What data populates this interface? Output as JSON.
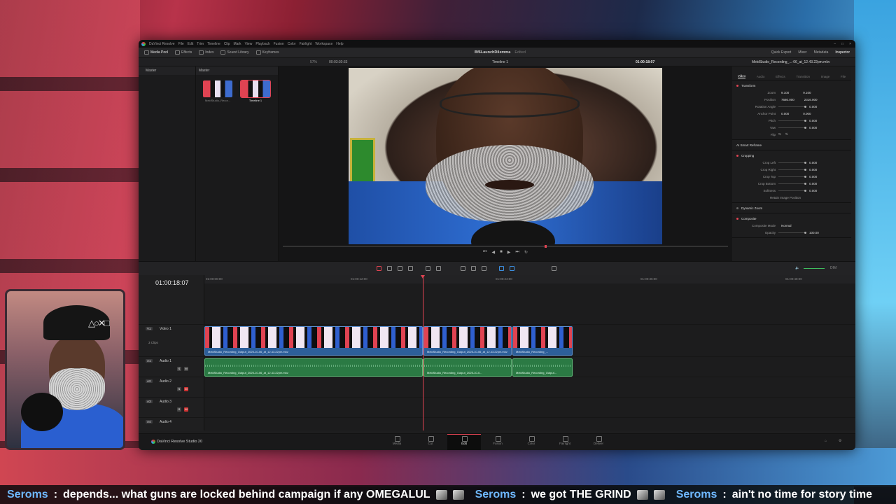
{
  "app": {
    "menu": [
      "DaVinci Resolve",
      "File",
      "Edit",
      "Trim",
      "Timeline",
      "Clip",
      "Mark",
      "View",
      "Playback",
      "Fusion",
      "Color",
      "Fairlight",
      "Workspace",
      "Help"
    ],
    "toolbar_left": [
      "Media Pool",
      "Effects",
      "Index",
      "Sound Library",
      "Keyframes"
    ],
    "project_title": "Bf6LaunchDilemma",
    "project_status": "Edited",
    "toolbar_right": [
      "Quick Export",
      "Mixer",
      "Metadata",
      "Inspector"
    ],
    "zoom": "57%",
    "source_timecode": "00:03:30:33",
    "timeline_name": "Timeline 1",
    "record_timecode": "01:00:18:07",
    "clip_name": "MeldStudio_Recording_...-06_at_12.43.22pm.mkv"
  },
  "bins": {
    "header": "Master"
  },
  "media_pool": {
    "header": "Master",
    "items": [
      {
        "label": "MeldStudio_Recor..."
      },
      {
        "label": "Timeline 1"
      }
    ]
  },
  "inspector": {
    "tabs": [
      "Video",
      "Audio",
      "Effects",
      "Transition",
      "Image",
      "File"
    ],
    "transform": {
      "title": "Transform",
      "zoom_label": "Zoom",
      "zoom_x": "9.100",
      "zoom_y": "9.100",
      "position_label": "Position",
      "position_x": "7680.000",
      "position_y": "2316.000",
      "rotation_label": "Rotation Angle",
      "rotation": "0.000",
      "anchor_label": "Anchor Point",
      "anchor_x": "0.000",
      "anchor_y": "0.000",
      "pitch_label": "Pitch",
      "pitch": "0.000",
      "yaw_label": "Yaw",
      "yaw": "0.000",
      "flip_label": "Flip"
    },
    "smart_reframe": "AI Smart Reframe",
    "cropping": {
      "title": "Cropping",
      "left_label": "Crop Left",
      "left": "0.000",
      "right_label": "Crop Right",
      "right": "0.000",
      "top_label": "Crop Top",
      "top": "0.000",
      "bottom_label": "Crop Bottom",
      "bottom": "0.000",
      "softness_label": "Softness",
      "softness": "0.000",
      "retain_label": "Retain Image Position"
    },
    "dynamic_zoom": {
      "title": "Dynamic Zoom"
    },
    "composite": {
      "title": "Composite",
      "mode_label": "Composite Mode",
      "mode": "Normal",
      "opacity_label": "Opacity",
      "opacity": "100.00"
    }
  },
  "timeline": {
    "timecode": "01:00:18:07",
    "ruler": [
      "01:00:00:00",
      "01:00:12:00",
      "01:00:24:00",
      "01:00:36:00",
      "01:00:48:00"
    ],
    "tracks": [
      {
        "tag": "V1",
        "name": "Video 1",
        "sub": "3 Clips"
      },
      {
        "tag": "A1",
        "name": "Audio 1",
        "level": "2.0"
      },
      {
        "tag": "A2",
        "name": "Audio 2",
        "level": "2.0"
      },
      {
        "tag": "A3",
        "name": "Audio 3",
        "level": "2.0"
      },
      {
        "tag": "A4",
        "name": "Audio 4",
        "level": "2.0"
      }
    ],
    "video_clips": [
      {
        "name": "MeldStudio_Recording_Output_2025-10-06_at_12.43.22pm.mkv"
      },
      {
        "name": "MeldStudio_Recording_Output_2025-10-06_at_12.43.22pm.mkv"
      },
      {
        "name": "MeldStudio_Recording_..."
      }
    ],
    "audio_clips": [
      {
        "name": "MeldStudio_Recording_Output_2025-10-06_at_12.43.22pm.mkv"
      },
      {
        "name": "MeldStudio_Recording_Output_2025-10-0..."
      },
      {
        "name": "MeldStudio_Recording_Output..."
      }
    ],
    "meter_label": "DIM"
  },
  "pagebar": {
    "brand": "DaVinci Resolve Studio 20",
    "pages": [
      "Media",
      "Cut",
      "Edit",
      "Fusion",
      "Color",
      "Fairlight",
      "Deliver"
    ],
    "active_page": "Edit"
  },
  "chat": [
    {
      "user": "Seroms",
      "text": "depends... what guns are locked behind campaign if any OMEGALUL"
    },
    {
      "user": "Seroms",
      "text": "we got THE GRIND"
    },
    {
      "user": "Seroms",
      "text": "ain't no time for story time"
    }
  ],
  "colors": {
    "accent": "#e04352",
    "video_clip": "#2d5f9a",
    "audio_clip": "#2b7a44",
    "chat_user": "#6fb8ff"
  }
}
